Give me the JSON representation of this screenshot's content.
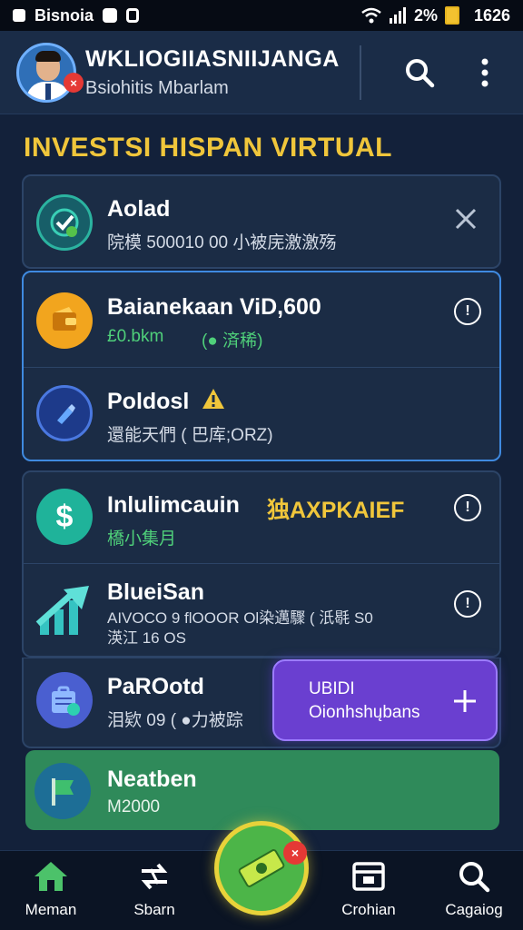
{
  "status_bar": {
    "carrier": "Bisnoia",
    "battery_percent": "2%",
    "time": "1626",
    "icons": [
      "sim-icon",
      "notification-icon",
      "alarm-icon",
      "wifi-icon",
      "signal-icon",
      "battery-icon"
    ]
  },
  "header": {
    "user_name": "WKLIOGIIASNIIJANGA",
    "user_subtitle": "Bsiohitis Mbarlam",
    "avatar_badge": "×",
    "actions": [
      "search-icon",
      "more-vert-icon"
    ]
  },
  "section_title": "INVESTSI HISPAN VIRTUAL",
  "cards": [
    {
      "title": "Aolad",
      "subtitle": "院模 500010 00 小被庑激激殇",
      "icon": "target-check-icon",
      "action": "close-icon",
      "accent": "#2bb3a0"
    },
    {
      "title": "Baianekaan ViD,600",
      "subtitle_green": "£0.bkm",
      "subtitle_badge": "(● 済稀)",
      "icon": "wallet-icon",
      "action": "info-icon",
      "accent": "#f2a51e"
    },
    {
      "title": "Poldosl",
      "subtitle": "還能天們 ( 巴库;ORZ)",
      "icon": "pen-icon",
      "warning_icon": "warning-icon",
      "action": "none",
      "accent": "#2c4fa0"
    },
    {
      "title": "Inlulimcauin",
      "title_suffix": "独AXPKAIEF",
      "subtitle": "橋小集月",
      "icon": "dollar-icon",
      "action": "info-icon",
      "accent": "#1fb39a"
    },
    {
      "title": "BlueiSan",
      "subtitle": "AIVOCO 9 flOOOR Ol染邁驟 ( 汦毼 S0",
      "subtitle2": "渶江 16 OS",
      "icon": "trend-up-icon",
      "action": "info-icon",
      "accent": "#35c3c2"
    },
    {
      "title": "PaROotd",
      "subtitle": "泪欵 09 ( ●力被踪",
      "icon": "briefcase-icon",
      "action": "none",
      "accent": "#4a5fd0"
    }
  ],
  "purple_panel": {
    "line1": "UBIDI",
    "line2": "Oionhshųbans",
    "icon": "plus-icon"
  },
  "green_panel": {
    "title": "Neatben",
    "subtitle": "M2000",
    "icon": "flag-icon"
  },
  "bottom_nav": [
    {
      "label": "Meman",
      "icon": "home-icon",
      "color": "#4cc26a"
    },
    {
      "label": "Sbarn",
      "icon": "swap-icon",
      "color": "#ffffff"
    },
    {
      "label": "",
      "icon": "cash-icon",
      "color": "#ffffff"
    },
    {
      "label": "Crohian",
      "icon": "calendar-icon",
      "color": "#ffffff"
    },
    {
      "label": "Cagaiog",
      "icon": "search-icon",
      "color": "#ffffff"
    }
  ],
  "center_badge": "×",
  "colors": {
    "background": "#13213a",
    "title_yellow": "#f0c63b",
    "green_text": "#4fd07a",
    "purple": "#6a3fd0",
    "green_panel": "#2f8a5a"
  }
}
